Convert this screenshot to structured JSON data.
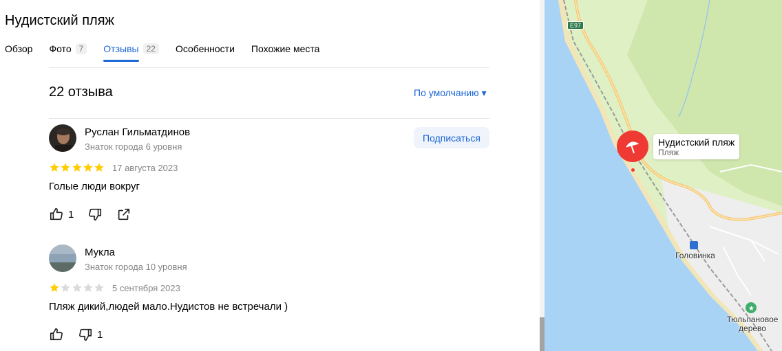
{
  "place": {
    "title": "Нудистский пляж"
  },
  "tabs": [
    {
      "label": "Обзор",
      "count": ""
    },
    {
      "label": "Фото",
      "count": "7"
    },
    {
      "label": "Отзывы",
      "count": "22"
    },
    {
      "label": "Особенности",
      "count": ""
    },
    {
      "label": "Похожие места",
      "count": ""
    }
  ],
  "active_tab": "Отзывы",
  "reviews_header": {
    "count_label": "22 отзыва",
    "sort_label": "По умолчанию ▾"
  },
  "reviews": [
    {
      "author": "Руслан Гильматдинов",
      "level": "Знаток города 6 уровня",
      "rating": 5,
      "date": "17 августа 2023",
      "text": "Голые люди вокруг",
      "likes": "1",
      "dislikes": "",
      "subscribe_label": "Подписаться"
    },
    {
      "author": "Мукла",
      "level": "Знаток города 10 уровня",
      "rating": 1,
      "date": "5 сентября 2023",
      "text": "Пляж дикий,людей мало.Нудистов не встречали )",
      "likes": "",
      "dislikes": "1"
    }
  ],
  "map": {
    "pin_name": "Нудистский пляж",
    "pin_type": "Пляж",
    "road_label": "E97",
    "labels": {
      "golovinka": "Головинка",
      "tree": "Тюльпановое дерево"
    }
  },
  "colors": {
    "accent": "#1c67d6",
    "star": "#ffcc00",
    "star_empty": "#d9d9d9",
    "pin": "#ef3a34",
    "sea": "#a9d3f5",
    "land": "#dff0c4"
  }
}
